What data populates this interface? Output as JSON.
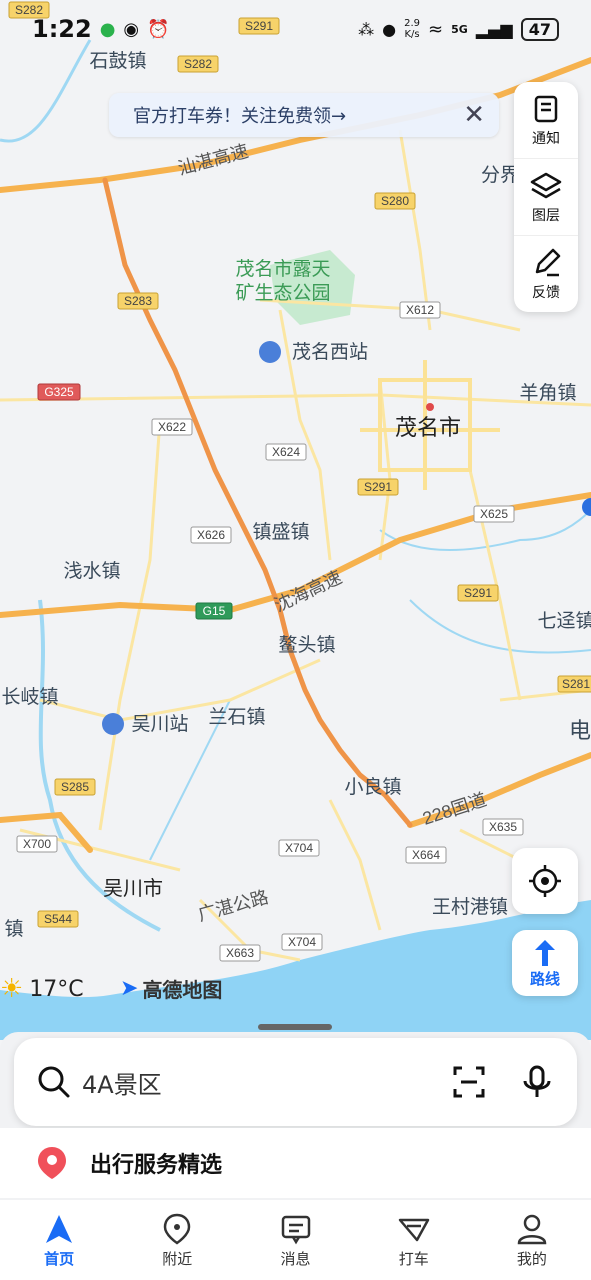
{
  "status_bar": {
    "time": "1:22",
    "speed_value": "2.9",
    "speed_unit": "K/s",
    "network": "5G",
    "battery": "47"
  },
  "coupon_banner": {
    "text": "官方打车券！关注免费领→"
  },
  "right_panel": {
    "items": [
      {
        "label": "通知",
        "icon": "notice-icon"
      },
      {
        "label": "图层",
        "icon": "layers-icon"
      },
      {
        "label": "反馈",
        "icon": "feedback-icon"
      }
    ]
  },
  "route_button": {
    "label": "路线"
  },
  "weather": {
    "temp": "17°C",
    "icon": "sun-icon"
  },
  "brand": {
    "name": "高德地图"
  },
  "search": {
    "placeholder": "4A景区"
  },
  "services": {
    "title": "出行服务精选"
  },
  "tabs": [
    {
      "label": "首页",
      "icon": "home-nav-icon",
      "active": true
    },
    {
      "label": "附近",
      "icon": "location-pin-icon",
      "active": false
    },
    {
      "label": "消息",
      "icon": "message-icon",
      "active": false
    },
    {
      "label": "打车",
      "icon": "taxi-icon",
      "active": false
    },
    {
      "label": "我的",
      "icon": "user-icon",
      "active": false
    }
  ],
  "map": {
    "places": {
      "shigu": "石鼓镇",
      "ludian": "露天",
      "park1": "茂名市露天",
      "park2": "矿生态公园",
      "xizhan": "茂名西站",
      "maoming": "茂名市",
      "yangjiao": "羊角镇",
      "zhensheng": "镇盛镇",
      "qianshui": "浅水镇",
      "aotou": "鳌头镇",
      "changqi": "长岐镇",
      "wuchuanzhan": "吴川站",
      "lanshi": "兰石镇",
      "xiaoliang": "小良镇",
      "wuchuan": "吴川市",
      "wangcun": "王村港镇",
      "qijing": "七迳镇",
      "fenjie": "分界",
      "dian": "电",
      "daozhen": "道",
      "jie": "镇",
      "zhen_left": "镇"
    },
    "roads": {
      "s282a": "S282",
      "s282b": "S282",
      "s291a": "S291",
      "s291b": "S291",
      "s291c": "S291",
      "s280": "S280",
      "s283": "S283",
      "g325": "G325",
      "x622": "X622",
      "x624": "X624",
      "x626": "X626",
      "x612": "X612",
      "x625": "X625",
      "g15": "G15",
      "s285": "S285",
      "x700": "X700",
      "x704a": "X704",
      "x704b": "X704",
      "x664": "X664",
      "x635": "X635",
      "s544": "S544",
      "x663": "X663",
      "s281": "S281",
      "shantan": "汕湛高速",
      "shenhai": "沈海高速",
      "gz": "广湛公路",
      "g228": "228国道",
      "shanghighway": "汕湛高速"
    }
  },
  "colors": {
    "accent": "#1a6cf5",
    "route": "#ef9448",
    "highway": "#f6b24e",
    "road": "#fbe296",
    "sea": "#8fd3f5",
    "park": "#b9e4b0"
  }
}
